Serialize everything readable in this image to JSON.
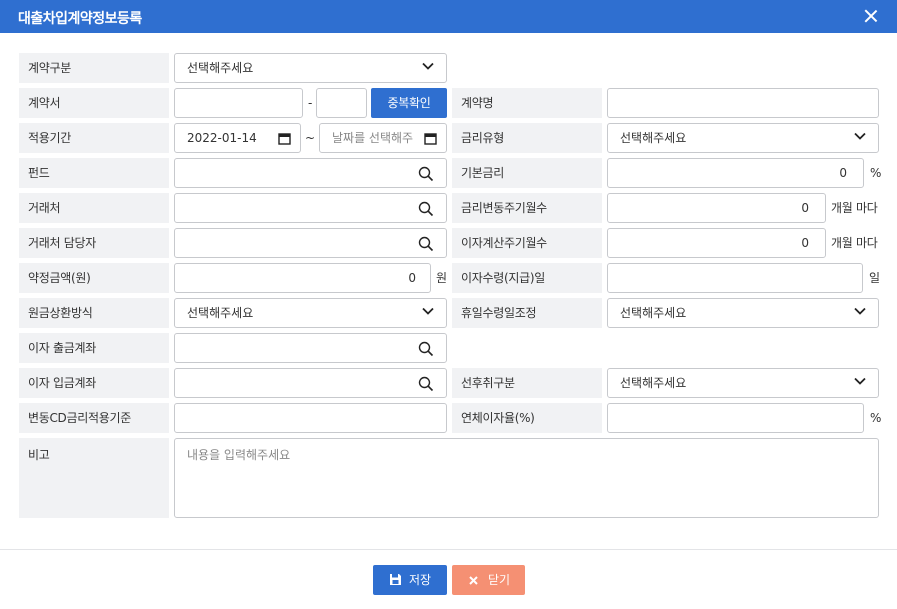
{
  "dialog": {
    "title": "대출차입계약정보등록"
  },
  "labels": {
    "contract_type": "계약구분",
    "contract_no": "계약서",
    "contract_name": "계약명",
    "apply_period": "적용기간",
    "rate_type": "금리유형",
    "fund": "펀드",
    "base_rate": "기본금리",
    "counterparty": "거래처",
    "rate_change_cycle": "금리변동주기월수",
    "counterparty_manager": "거래처 담당자",
    "interest_calc_cycle": "이자계산주기월수",
    "contract_amount": "약정금액(원)",
    "interest_receipt_day": "이자수령(지급)일",
    "repayment_method": "원금상환방식",
    "holiday_adjust": "휴일수령일조정",
    "interest_out_account": "이자 출금계좌",
    "interest_in_account": "이자 입금계좌",
    "priority_type": "선후취구분",
    "cd_rate_basis": "변동CD금리적용기준",
    "overdue_rate": "연체이자율(%)",
    "remarks": "비고"
  },
  "fields": {
    "contract_type": "선택해주세요",
    "contract_no_sep": "-",
    "dup_check_button": "중복확인",
    "period_start": "2022-01-14",
    "period_sep": "~",
    "period_end_placeholder": "날짜를 선택해주",
    "rate_type": "선택해주세요",
    "base_rate": "0",
    "base_rate_unit": "%",
    "rate_change_cycle": "0",
    "rate_change_unit": "개월 마다",
    "interest_calc_cycle": "0",
    "interest_calc_unit": "개월 마다",
    "contract_amount": "0",
    "contract_amount_unit": "원",
    "interest_receipt_unit": "일",
    "repayment_method": "선택해주세요",
    "holiday_adjust": "선택해주세요",
    "priority_type": "선택해주세요",
    "overdue_rate_unit": "%",
    "remarks_placeholder": "내용을 입력해주세요"
  },
  "footer": {
    "save_label": "저장",
    "close_label": "닫기"
  },
  "colors": {
    "primary": "#2f6fd0",
    "close_button": "#f59073",
    "label_bg": "#f1f2f4",
    "border": "#c7c9cd"
  },
  "icons": [
    "close-icon",
    "chevron-down-icon",
    "search-icon",
    "calendar-icon",
    "save-icon",
    "x-icon"
  ]
}
